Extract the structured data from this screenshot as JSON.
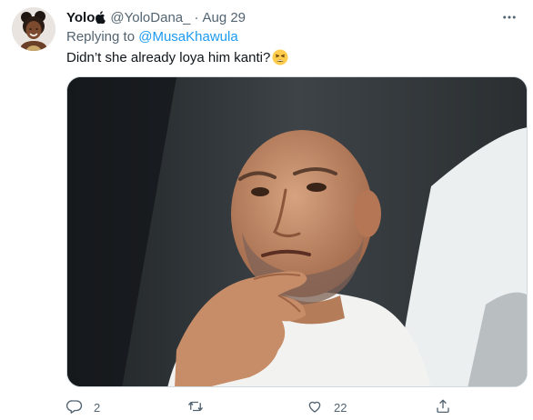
{
  "tweet": {
    "author": {
      "display_name": "Yolo",
      "name_icon": "apple-icon",
      "handle": "@YoloDana_",
      "separator": "·",
      "date": "Aug 29",
      "avatar_icon": "avatar"
    },
    "reply": {
      "prefix": "Replying to",
      "mention": "@MusaKhawula"
    },
    "text": "Didn’t she already loya him kanti?",
    "emoji": "weary-face-emoji",
    "media": {
      "kind": "photo"
    },
    "actions": {
      "reply": {
        "icon": "reply-icon",
        "count": "2"
      },
      "retweet": {
        "icon": "retweet-icon",
        "count": ""
      },
      "like": {
        "icon": "heart-icon",
        "count": "22"
      },
      "share": {
        "icon": "share-icon",
        "count": ""
      }
    },
    "more": {
      "icon": "more-options-icon"
    }
  },
  "colors": {
    "text_primary": "#0f1419",
    "text_secondary": "#536471",
    "link": "#1d9bf0",
    "border": "#cfd9de"
  }
}
